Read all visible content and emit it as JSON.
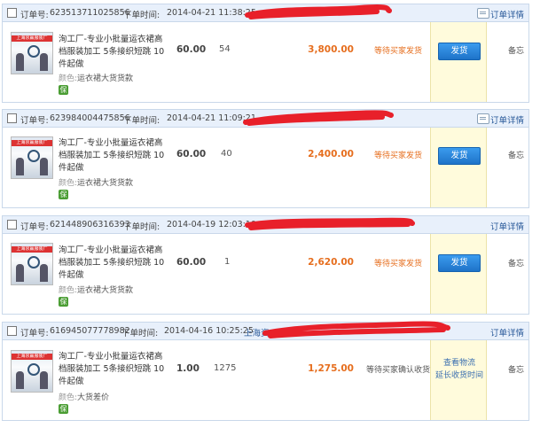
{
  "labels": {
    "order_no": "订单号:",
    "order_time": "下单时间:",
    "detail": "订单详情",
    "color": "颜色:",
    "note": "备忘",
    "thumb_text": "上海京赢服装厂",
    "badge": "保"
  },
  "orders": [
    {
      "order_no": "623513711025856",
      "time": "2014-04-21 11:38:25",
      "title": "洵工厂-专业小批量运衣裙高档服装加工 5条接织短跳 10件起做",
      "color": "运衣裙大货货款",
      "price": "60.00",
      "qty": "54",
      "total": "3,800.00",
      "status": "等待买家发货",
      "action": "发货"
    },
    {
      "order_no": "623984004475856",
      "time": "2014-04-21 11:09:21",
      "title": "洵工厂-专业小批量运衣裙高档服装加工 5条接织短跳 10件起做",
      "color": "运衣裙大货货款",
      "price": "60.00",
      "qty": "40",
      "total": "2,400.00",
      "status": "等待买家发货",
      "action": "发货"
    },
    {
      "order_no": "621448906316393",
      "time": "2014-04-19 12:03:10",
      "title": "洵工厂-专业小批量运衣裙高档服装加工 5条接织短跳 10件起做",
      "color": "运衣裙大货货款",
      "price": "60.00",
      "qty": "1",
      "total": "2,620.00",
      "status": "等待买家发货",
      "action": "发货"
    },
    {
      "order_no": "616945077778982",
      "time": "2014-04-16 10:25:25",
      "seller_partial": "上海资",
      "title": "洵工厂-专业小批量运衣裙高档服装加工 5条接织短跳 10件起做",
      "color": "大货差价",
      "price": "1.00",
      "qty": "1275",
      "total": "1,275.00",
      "status": "等待买家确认收货",
      "link1": "查看物流",
      "link2": "延长收货时间"
    }
  ],
  "colors": {
    "header_bg": "#e8f0fb",
    "accent_orange": "#e66e1e",
    "button_blue": "#1e73c8",
    "action_col_bg": "#fffbdc",
    "scribble_red": "#e8202a"
  }
}
